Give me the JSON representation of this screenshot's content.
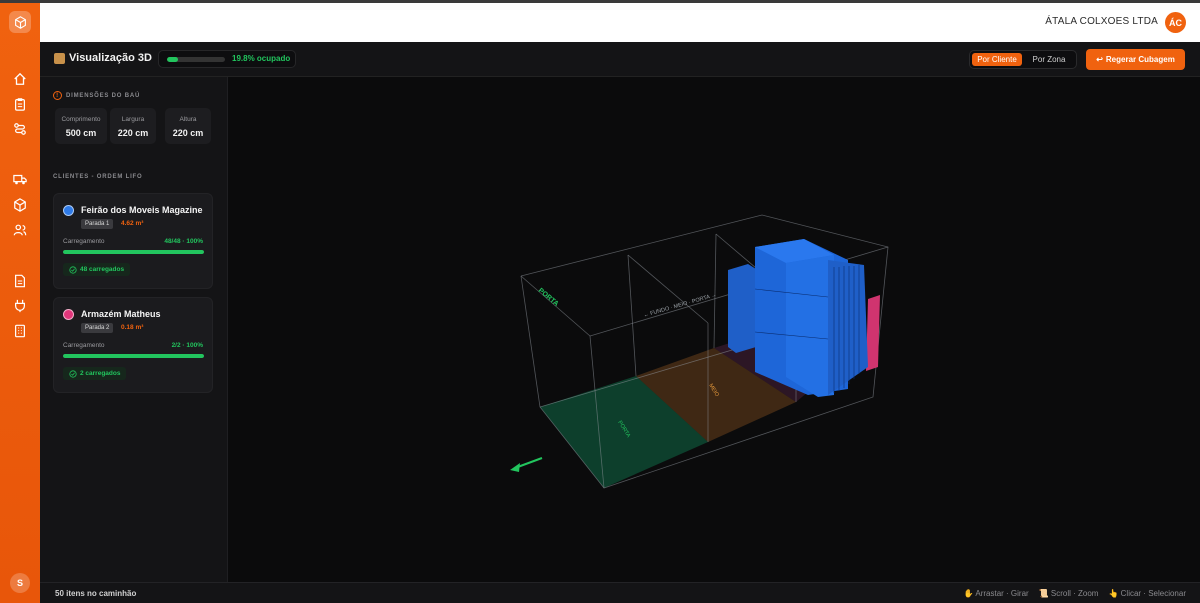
{
  "header": {
    "company": "ÁTALA COLXOES LTDA",
    "avatar": "ÁC"
  },
  "toolbar": {
    "title": "Visualização 3D",
    "occupancy_label": "19.8% ocupado",
    "occupancy_fraction": 0.198,
    "view_modes": [
      "Por Cliente",
      "Por Zona"
    ],
    "active_view": "Por Cliente",
    "regen_label": "Regerar Cubagem",
    "regen_icon": "↩"
  },
  "sidebar": {
    "dims_title": "DIMENSÕES DO BAÚ",
    "dims": [
      {
        "label": "Comprimento",
        "value": "500 cm"
      },
      {
        "label": "Largura",
        "value": "220 cm"
      },
      {
        "label": "Altura",
        "value": "220 cm"
      }
    ],
    "clients_title": "CLIENTES - ORDEM LIFO",
    "clients": [
      {
        "name": "Feirão dos Moveis Magazine",
        "stop": "Parada 1",
        "volume": "4.62 m³",
        "load_label": "Carregamento",
        "load_count": "48/48 · 100%",
        "load_fraction": 1.0,
        "loaded": "48 carregados",
        "color": "#2f7be8"
      },
      {
        "name": "Armazém Matheus",
        "stop": "Parada 2",
        "volume": "0.18 m³",
        "load_label": "Carregamento",
        "load_count": "2/2 · 100%",
        "load_fraction": 1.0,
        "loaded": "2 carregados",
        "color": "#e0367a"
      }
    ]
  },
  "viewport": {
    "door_label": "PORTA",
    "wall_label": "← FUNDO · MEIO · PORTA →",
    "zone_door": "PORTA",
    "zone_middle": "MEIO"
  },
  "footer": {
    "items_count": "50 itens no caminhão",
    "hints": [
      "Arrastar · Girar",
      "Scroll · Zoom",
      "Clicar · Selecionar"
    ]
  },
  "colors": {
    "accent": "#f0620f",
    "success": "#22c55e",
    "client1": "#2f7be8",
    "client2": "#e0367a"
  }
}
